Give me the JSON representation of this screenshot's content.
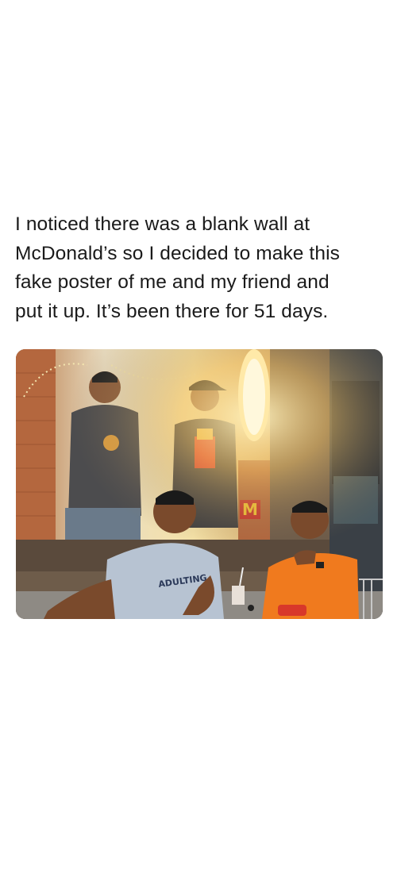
{
  "post": {
    "text_lines": [
      "I noticed there was a blank wall at",
      "McDonald’s so I decided to make this",
      "fake poster of me and my friend and",
      "put it up. It’s been there for 51 days."
    ]
  },
  "photo": {
    "shirt_text": "ADULTING",
    "logo": "M",
    "colors": {
      "wall": "#7a6753",
      "poster_bg": "#e8d9b0",
      "lamp": "#ffd77a",
      "orange_shirt": "#f07a1e",
      "grey_shirt": "#9aa8b8"
    }
  }
}
